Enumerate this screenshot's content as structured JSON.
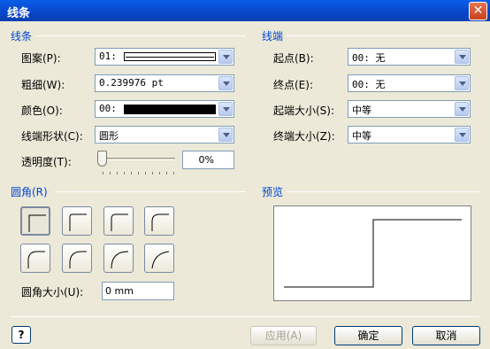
{
  "window": {
    "title": "线条",
    "close_icon": "close-icon"
  },
  "line_section": {
    "title": "线条",
    "pattern": {
      "label": "图案(P):",
      "value": "01:"
    },
    "weight": {
      "label": "粗细(W):",
      "value": "0.239976 pt"
    },
    "color": {
      "label": "颜色(O):",
      "value": "00:",
      "swatch": "#000000"
    },
    "cap": {
      "label": "线端形状(C):",
      "value": "圆形"
    },
    "transparency": {
      "label": "透明度(T):",
      "value": "0%",
      "level": 0
    }
  },
  "ends_section": {
    "title": "线端",
    "begin": {
      "label": "起点(B):",
      "value": "00: 无"
    },
    "end": {
      "label": "终点(E):",
      "value": "00: 无"
    },
    "begin_size": {
      "label": "起端大小(S):",
      "value": "中等"
    },
    "end_size": {
      "label": "终端大小(Z):",
      "value": "中等"
    }
  },
  "corners_section": {
    "title": "圆角(R)",
    "size": {
      "label": "圆角大小(U):",
      "value": "0 mm"
    }
  },
  "preview_section": {
    "title": "预览"
  },
  "buttons": {
    "help": "?",
    "apply": "应用(A)",
    "ok": "确定",
    "cancel": "取消"
  }
}
